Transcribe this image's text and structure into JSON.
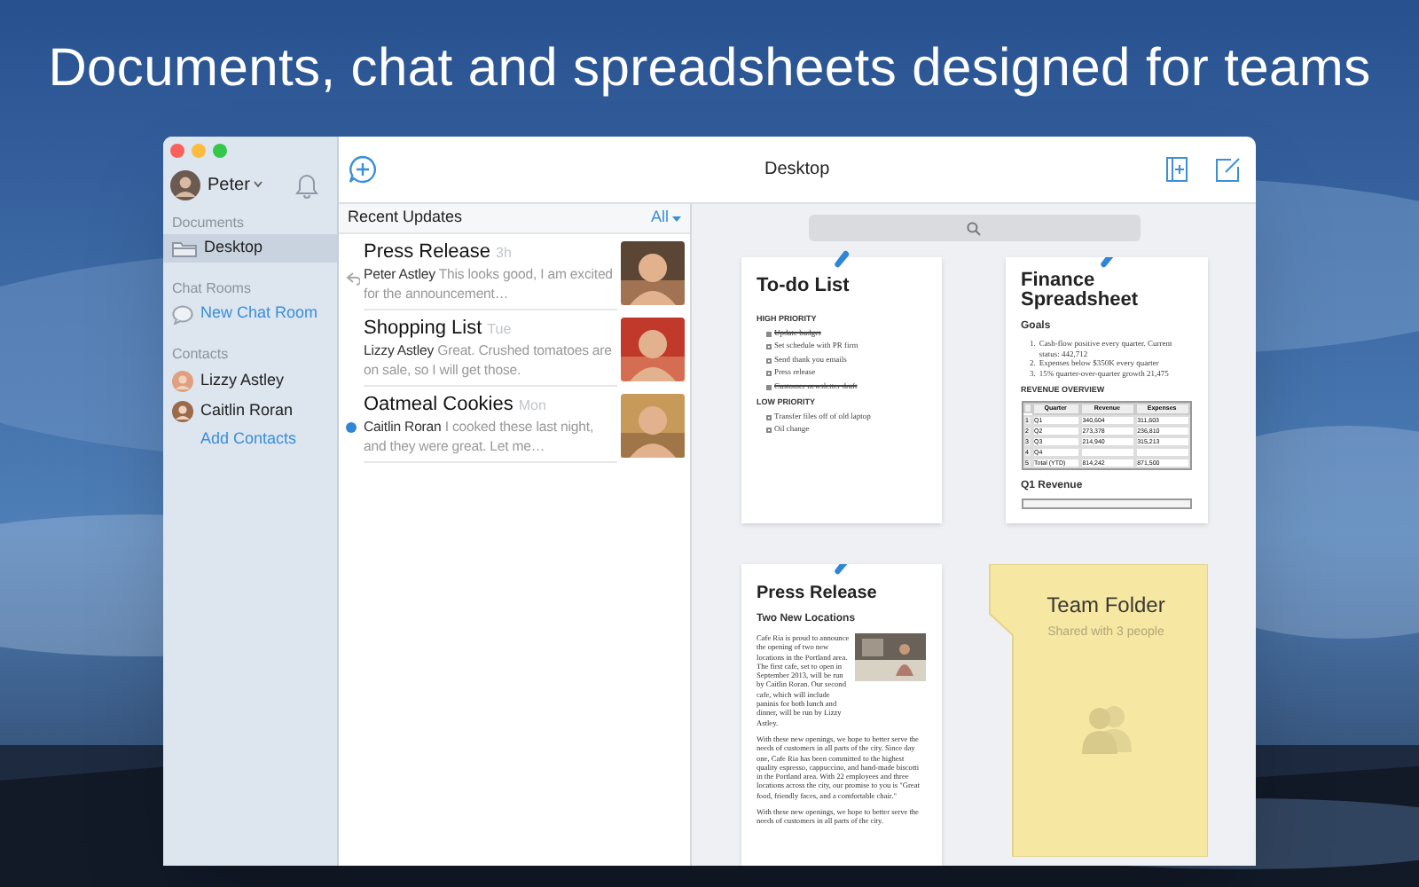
{
  "headline": "Documents, chat and spreadsheets designed for teams",
  "sidebar": {
    "user": "Peter",
    "sections": [
      {
        "heading": "Documents",
        "items": [
          {
            "label": "Desktop",
            "kind": "folder",
            "selected": true
          }
        ]
      },
      {
        "heading": "Chat Rooms",
        "items": [
          {
            "label": "New Chat Room",
            "kind": "chat-action",
            "selected": false
          }
        ]
      },
      {
        "heading": "Contacts",
        "items": [
          {
            "label": "Lizzy Astley",
            "kind": "contact",
            "selected": false
          },
          {
            "label": "Caitlin Roran",
            "kind": "contact",
            "selected": false
          },
          {
            "label": "Add Contacts",
            "kind": "action",
            "selected": false
          }
        ]
      }
    ]
  },
  "toolbar": {
    "title": "Desktop"
  },
  "updates": {
    "title": "Recent Updates",
    "filter": "All",
    "items": [
      {
        "title": "Press Release",
        "time": "3h",
        "author": "Peter Astley",
        "preview": "This looks good, I am excited for the announcement…",
        "unread": false,
        "replied": true
      },
      {
        "title": "Shopping List",
        "time": "Tue",
        "author": "Lizzy Astley",
        "preview": "Great. Crushed tomatoes are on sale, so I will get those.",
        "unread": false,
        "replied": false
      },
      {
        "title": "Oatmeal Cookies",
        "time": "Mon",
        "author": "Caitlin Roran",
        "preview": "I cooked these last night, and they were great. Let me…",
        "unread": true,
        "replied": false
      }
    ]
  },
  "documents": [
    {
      "kind": "todo",
      "title": "To-do List",
      "groups": [
        {
          "heading": "HIGH PRIORITY",
          "tasks": [
            {
              "text": "Update budget",
              "checked": true
            },
            {
              "text": "Set schedule with PR firm",
              "checked": false
            },
            {
              "text": "Send thank you emails",
              "checked": false
            },
            {
              "text": "Press release",
              "checked": false
            },
            {
              "text": "Customer newsletter draft",
              "checked": true
            }
          ]
        },
        {
          "heading": "LOW PRIORITY",
          "tasks": [
            {
              "text": "Transfer files off of old laptop",
              "checked": false
            },
            {
              "text": "Oil change",
              "checked": false
            }
          ]
        }
      ]
    },
    {
      "kind": "spreadsheet",
      "title": "Finance Spreadsheet",
      "goals_heading": "Goals",
      "goals": [
        {
          "number": "1.",
          "text": "Cash-flow positive every quarter. Current status: 442,712"
        },
        {
          "number": "2.",
          "text": "Expenses below $350K every quarter"
        },
        {
          "number": "3.",
          "text": "15% quarter-over-quarter growth 21,475"
        }
      ],
      "table_heading": "REVENUE OVERVIEW",
      "columns": [
        "Quarter",
        "Revenue",
        "Expenses"
      ],
      "rows": [
        [
          "1",
          "Q1",
          "340,604",
          "311,603"
        ],
        [
          "2",
          "Q2",
          "273,378",
          "236,810"
        ],
        [
          "3",
          "Q3",
          "214,940",
          "315,213"
        ],
        [
          "4",
          "Q4",
          "",
          ""
        ],
        [
          "5",
          "Total (YTD)",
          "814,242",
          "871,500"
        ]
      ],
      "chart_heading": "Q1 Revenue"
    },
    {
      "kind": "press",
      "title": "Press Release",
      "subtitle": "Two New Locations",
      "paragraphs": [
        "Cafe Ria is proud to announce the opening of two new locations in the Portland area. The first cafe, set to open in September 2013, will be run by Caitlin Roran. Our second cafe, which will include paninis for both lunch and dinner, will be run by Lizzy Astley.",
        "With these new openings, we hope to better serve the needs of customers in all parts of the city. Since day one, Cafe Ria has been committed to the highest quality espresso, cappuccino, and hand-made biscotti in the Portland area. With 22 employees and three locations across the city, our promise to you is \"Great food, friendly faces, and a comfortable chair.\"",
        "With these new openings, we hope to better serve the needs of customers in all parts of the city."
      ]
    },
    {
      "kind": "folder",
      "title": "Team Folder",
      "subtitle": "Shared with 3 people"
    }
  ]
}
